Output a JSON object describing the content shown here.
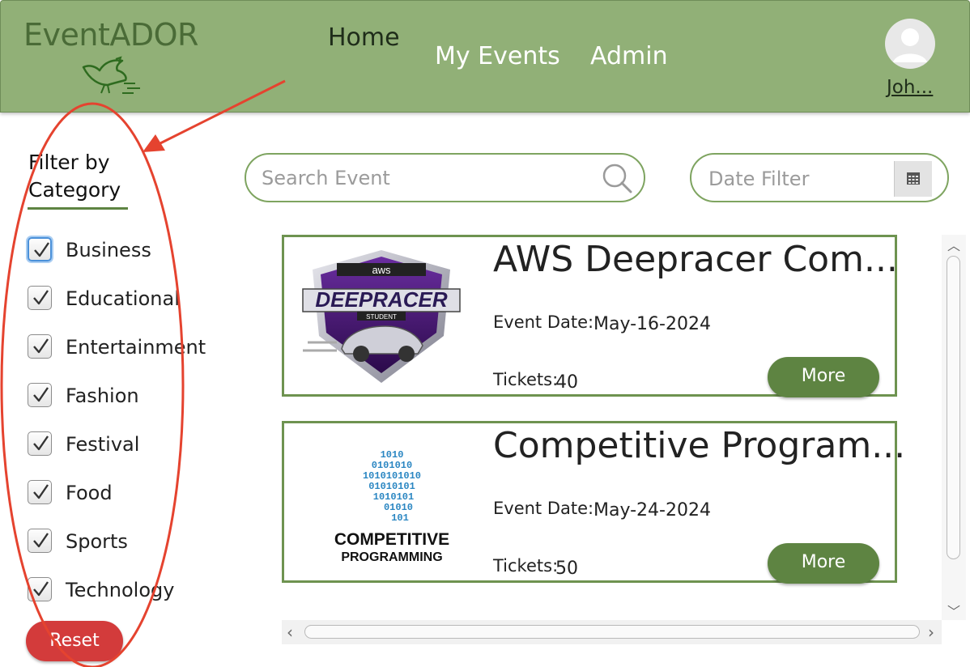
{
  "header": {
    "logo_text": "EventADOR",
    "nav": [
      "Home",
      "My Events",
      "Admin"
    ],
    "active_nav": "Home",
    "user_name": "Joh..."
  },
  "filter": {
    "title_line1": "Filter by",
    "title_line2": "Category",
    "categories": [
      {
        "label": "Business",
        "checked": true
      },
      {
        "label": "Educational",
        "checked": true
      },
      {
        "label": "Entertainment",
        "checked": true
      },
      {
        "label": "Fashion",
        "checked": true
      },
      {
        "label": "Festival",
        "checked": true
      },
      {
        "label": "Food",
        "checked": true
      },
      {
        "label": "Sports",
        "checked": true
      },
      {
        "label": "Technology",
        "checked": true
      }
    ],
    "reset_label": "Reset"
  },
  "search": {
    "placeholder": "Search Event"
  },
  "date_filter": {
    "placeholder": "Date Filter"
  },
  "events": [
    {
      "title": "AWS Deepracer Com...",
      "date_label": "Event Date:",
      "date": "May-16-2024",
      "tickets_label": "Tickets:",
      "tickets": "40",
      "more_label": "More",
      "logo": {
        "top": "aws",
        "main": "DEEPRACER",
        "sub": "STUDENT"
      }
    },
    {
      "title": "Competitive Program...",
      "date_label": "Event Date:",
      "date": "May-24-2024",
      "tickets_label": "Tickets:",
      "tickets": "50",
      "more_label": "More",
      "logo": {
        "line1": "COMPETITIVE",
        "line2": "PROGRAMMING",
        "binary": [
          "1010",
          "0101010",
          "1010101010",
          "01010101",
          "1010101",
          "01010",
          "101"
        ]
      }
    }
  ],
  "colors": {
    "header_bg": "#91b077",
    "accent": "#5e8442",
    "reset": "#d33b3b",
    "annotation": "#e5432f"
  }
}
